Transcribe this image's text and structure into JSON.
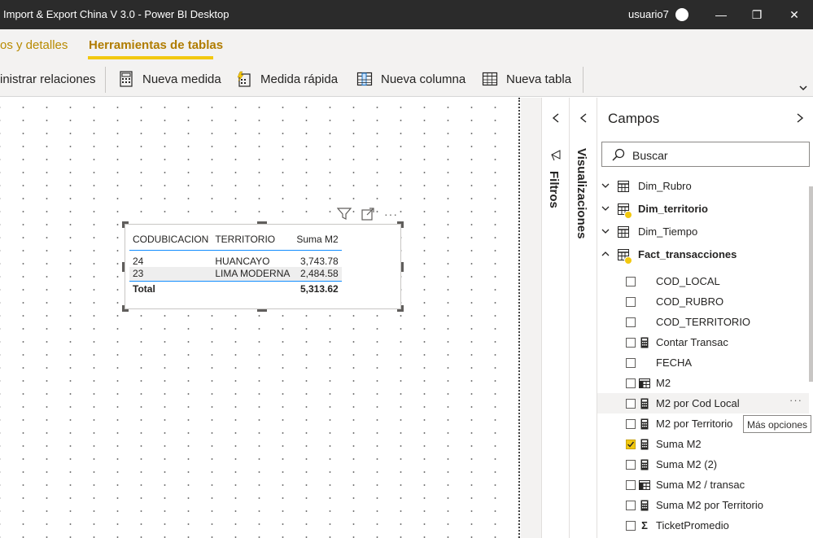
{
  "titlebar": {
    "title": "Import & Export China V 3.0 - Power BI Desktop",
    "user": "usuario7",
    "minimize": "—",
    "restore": "❐",
    "close": "✕"
  },
  "ribbon_tabs": [
    {
      "label": "os y detalles",
      "active": false
    },
    {
      "label": "Herramientas de tablas",
      "active": true
    }
  ],
  "toolbar": {
    "manage_relations": "inistrar relaciones",
    "new_measure": "Nueva medida",
    "quick_measure": "Medida rápida",
    "new_column": "Nueva columna",
    "new_table": "Nueva tabla"
  },
  "visual_table": {
    "headers": [
      "CODUBICACION",
      "TERRITORIO",
      "Suma M2"
    ],
    "rows": [
      [
        "24",
        "HUANCAYO",
        "3,743.78"
      ],
      [
        "23",
        "LIMA MODERNA",
        "2,484.58"
      ]
    ],
    "total_label": "Total",
    "total_value": "5,313.62"
  },
  "panes": {
    "filtros": "Filtros",
    "visualizaciones": "Visualizaciones",
    "campos": "Campos",
    "search_placeholder": "Buscar"
  },
  "tables": [
    {
      "name": "Dim_Rubro",
      "bold": false,
      "expanded": false,
      "badge": false
    },
    {
      "name": "Dim_territorio",
      "bold": true,
      "expanded": false,
      "badge": true
    },
    {
      "name": "Dim_Tiempo",
      "bold": false,
      "expanded": false,
      "badge": false
    },
    {
      "name": "Fact_transacciones",
      "bold": true,
      "expanded": true,
      "badge": true
    }
  ],
  "fields": [
    {
      "name": "COD_LOCAL",
      "icon": "none",
      "checked": false
    },
    {
      "name": "COD_RUBRO",
      "icon": "none",
      "checked": false
    },
    {
      "name": "COD_TERRITORIO",
      "icon": "none",
      "checked": false
    },
    {
      "name": "Contar Transac",
      "icon": "measure",
      "checked": false
    },
    {
      "name": "FECHA",
      "icon": "none",
      "checked": false
    },
    {
      "name": "M2",
      "icon": "column",
      "checked": false
    },
    {
      "name": "M2 por Cod Local",
      "icon": "measure",
      "checked": false
    },
    {
      "name": "M2 por Territorio",
      "icon": "measure",
      "checked": false
    },
    {
      "name": "Suma M2",
      "icon": "measure",
      "checked": true
    },
    {
      "name": "Suma M2 (2)",
      "icon": "measure",
      "checked": false
    },
    {
      "name": "Suma M2 / transac",
      "icon": "column",
      "checked": false
    },
    {
      "name": "Suma M2 por Territorio",
      "icon": "measure",
      "checked": false
    },
    {
      "name": "TicketPromedio",
      "icon": "sigma",
      "checked": false
    }
  ],
  "tooltip": "Más opciones",
  "more_dots": "···",
  "colors": {
    "accent": "#f2c80f",
    "tab_text": "#b07c00",
    "titlebar_bg": "#2b2b2b",
    "table_line": "#118dff"
  }
}
